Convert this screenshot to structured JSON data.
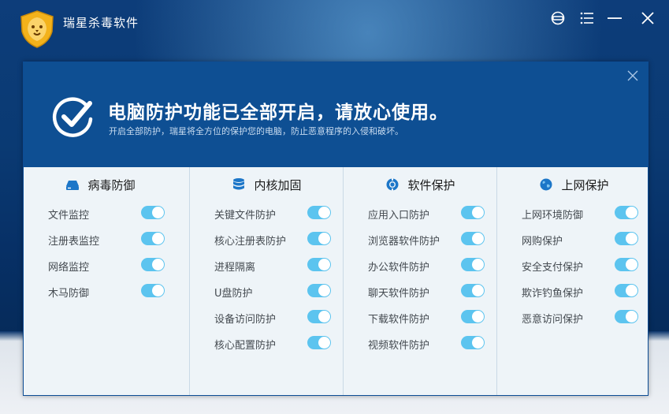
{
  "app": {
    "title": "瑞星杀毒软件"
  },
  "banner": {
    "headline": "电脑防护功能已全部开启，请放心使用。",
    "subline": "开启全部防护，瑞星将全方位的保护您的电脑，防止恶意程序的入侵和破坏。"
  },
  "colors": {
    "banner_bg": "#0e4f93",
    "toggle_on": "#5cc4ef",
    "panel_bg": "#eef4f8"
  },
  "columns": [
    {
      "title": "病毒防御",
      "icon": "hard-drive-icon",
      "items": [
        {
          "label": "文件监控",
          "on": true
        },
        {
          "label": "注册表监控",
          "on": true
        },
        {
          "label": "网络监控",
          "on": true
        },
        {
          "label": "木马防御",
          "on": true
        }
      ]
    },
    {
      "title": "内核加固",
      "icon": "database-icon",
      "items": [
        {
          "label": "关键文件防护",
          "on": true
        },
        {
          "label": "核心注册表防护",
          "on": true
        },
        {
          "label": "进程隔离",
          "on": true
        },
        {
          "label": "U盘防护",
          "on": true
        },
        {
          "label": "设备访问防护",
          "on": true
        },
        {
          "label": "核心配置防护",
          "on": true
        }
      ]
    },
    {
      "title": "软件保护",
      "icon": "lifebuoy-icon",
      "items": [
        {
          "label": "应用入口防护",
          "on": true
        },
        {
          "label": "浏览器软件防护",
          "on": true
        },
        {
          "label": "办公软件防护",
          "on": true
        },
        {
          "label": "聊天软件防护",
          "on": true
        },
        {
          "label": "下载软件防护",
          "on": true
        },
        {
          "label": "视频软件防护",
          "on": true
        }
      ]
    },
    {
      "title": "上网保护",
      "icon": "globe-icon",
      "items": [
        {
          "label": "上网环境防御",
          "on": true
        },
        {
          "label": "网购保护",
          "on": true
        },
        {
          "label": "安全支付保护",
          "on": true
        },
        {
          "label": "欺诈钓鱼保护",
          "on": true
        },
        {
          "label": "恶意访问保护",
          "on": true
        }
      ]
    }
  ]
}
